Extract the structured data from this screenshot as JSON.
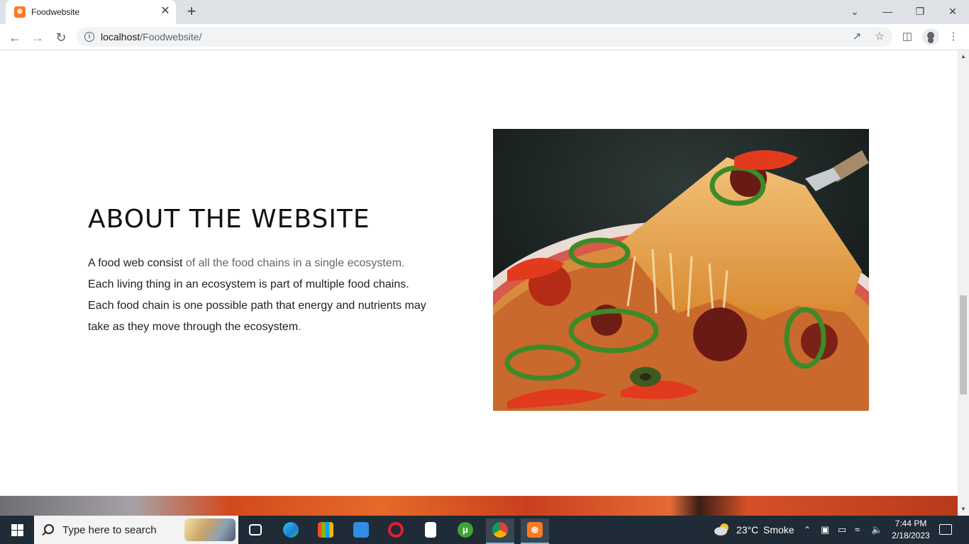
{
  "browser": {
    "tab_title": "Foodwebsite",
    "favicon": "xampp-icon",
    "url_host": "localhost",
    "url_path": "/Foodwebsite/"
  },
  "about": {
    "title": "ABOUT THE WEBSITE",
    "text_part1": "A food web consist ",
    "text_part2": "of all the food chains in a single ecosystem.",
    "text_part3": " Each living thing in an ecosystem is part of multiple food chains. Each food chain is one possible path that energy and nutrients may take as they move through the ecosystem",
    "text_part4": "."
  },
  "taskbar": {
    "search_placeholder": "Type here to search",
    "weather_temp": "23°C",
    "weather_desc": "Smoke",
    "time": "7:44 PM",
    "date": "2/18/2023"
  },
  "colors": {
    "accent": "#fb7a24",
    "taskbar_bg": "#1f2b36"
  }
}
